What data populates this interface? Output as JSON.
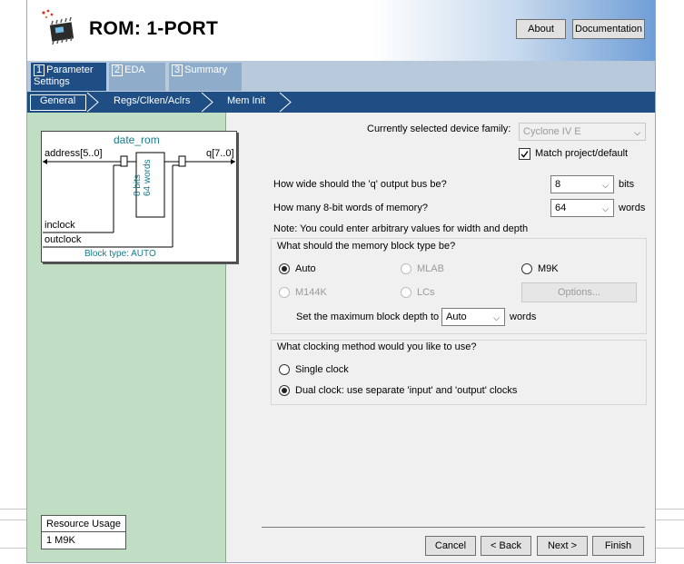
{
  "header": {
    "title": "ROM: 1-PORT",
    "about_label": "About",
    "documentation_label": "Documentation"
  },
  "tabs": [
    {
      "num": "1",
      "label": "Parameter Settings"
    },
    {
      "num": "2",
      "label": "EDA"
    },
    {
      "num": "3",
      "label": "Summary"
    }
  ],
  "subtabs": [
    "General",
    "Regs/Clken/Aclrs",
    "Mem Init"
  ],
  "diagram": {
    "name": "date_rom",
    "address": "address[5..0]",
    "q": "q[7..0]",
    "bits": "8 bits",
    "words": "64 words",
    "inclock": "inclock",
    "outclock": "outclock",
    "block_type": "Block type: AUTO"
  },
  "resource": {
    "title": "Resource Usage",
    "value": "1 M9K"
  },
  "settings": {
    "device_family_label": "Currently selected device family:",
    "device_family_value": "Cyclone IV E",
    "match_label": "Match project/default",
    "width_label": "How wide should the 'q' output bus be?",
    "width_value": "8",
    "width_unit": "bits",
    "words_label": "How many 8-bit words of memory?",
    "words_value": "64",
    "words_unit": "words",
    "note": "Note: You could enter arbitrary values for width and depth"
  },
  "memblock": {
    "legend": "What should the memory block type be?",
    "opt_auto": "Auto",
    "opt_mlab": "MLAB",
    "opt_m9k": "M9K",
    "opt_m144k": "M144K",
    "opt_lcs": "LCs",
    "options_button": "Options...",
    "depth_label": "Set the maximum block depth to",
    "depth_value": "Auto",
    "depth_unit": "words"
  },
  "clocking": {
    "legend": "What clocking method would you like to use?",
    "single": "Single clock",
    "dual": "Dual clock: use separate 'input' and 'output' clocks"
  },
  "footer": {
    "cancel": "Cancel",
    "back": "< Back",
    "next": "Next >",
    "finish": "Finish"
  }
}
